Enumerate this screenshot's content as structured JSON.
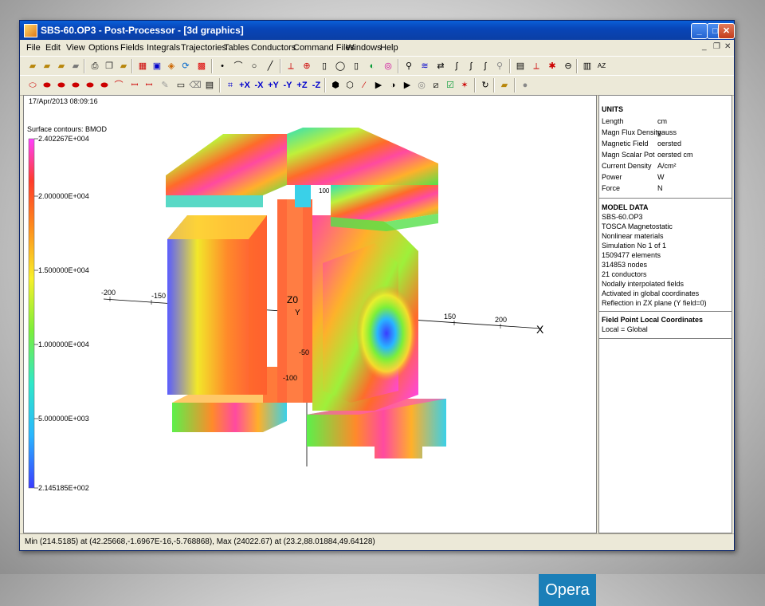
{
  "window": {
    "title": "SBS-60.OP3 - Post-Processor - [3d graphics]"
  },
  "menu": [
    "File",
    "Edit",
    "View",
    "Options",
    "Fields",
    "Integrals",
    "Trajectories",
    "Tables",
    "Conductors",
    "Command Files",
    "Windows",
    "Help"
  ],
  "canvas": {
    "timestamp": "17/Apr/2013 08:09:16",
    "legend_title": "Surface contours: BMOD",
    "legend_labels": [
      "2.402267E+004",
      "2.000000E+004",
      "1.500000E+004",
      "1.000000E+004",
      "5.000000E+003",
      "2.145185E+002"
    ],
    "axes": {
      "z": "Z",
      "x": "X",
      "z0": "Z0",
      "y": "Y",
      "ticks": [
        "-200",
        "-150",
        "150",
        "200",
        "-50",
        "-100",
        "100"
      ]
    },
    "logo": "Opera"
  },
  "info": {
    "units_heading": "UNITS",
    "units": [
      {
        "label": "Length",
        "value": "cm"
      },
      {
        "label": "Magn Flux Density",
        "value": "gauss"
      },
      {
        "label": "Magnetic Field",
        "value": "oersted"
      },
      {
        "label": "Magn Scalar Pot",
        "value": "oersted cm"
      },
      {
        "label": "Current Density",
        "value": "A/cm²"
      },
      {
        "label": "Power",
        "value": "W"
      },
      {
        "label": "Force",
        "value": "N"
      }
    ],
    "model_heading": "MODEL DATA",
    "model_lines": [
      "SBS-60.OP3",
      "TOSCA Magnetostatic",
      "Nonlinear materials",
      "Simulation No 1 of 1",
      "1509477 elements",
      "314853 nodes",
      "21 conductors",
      "Nodally interpolated fields",
      "Activated in global coordinates",
      "Reflection in ZX plane (Y field=0)"
    ],
    "field_heading": "Field Point Local Coordinates",
    "field_line": "Local = Global"
  },
  "toolbar2": {
    "axes": [
      "+X",
      "-X",
      "+Y",
      "-Y",
      "+Z",
      "-Z"
    ]
  },
  "status": "Min (214.5185) at (42.25668,-1.6967E-16,-5.768868), Max (24022.67) at (23.2,88.01884,49.64128)",
  "colors": {
    "titlebar": "#0a5fd8",
    "logo": "#1b7fb8"
  }
}
